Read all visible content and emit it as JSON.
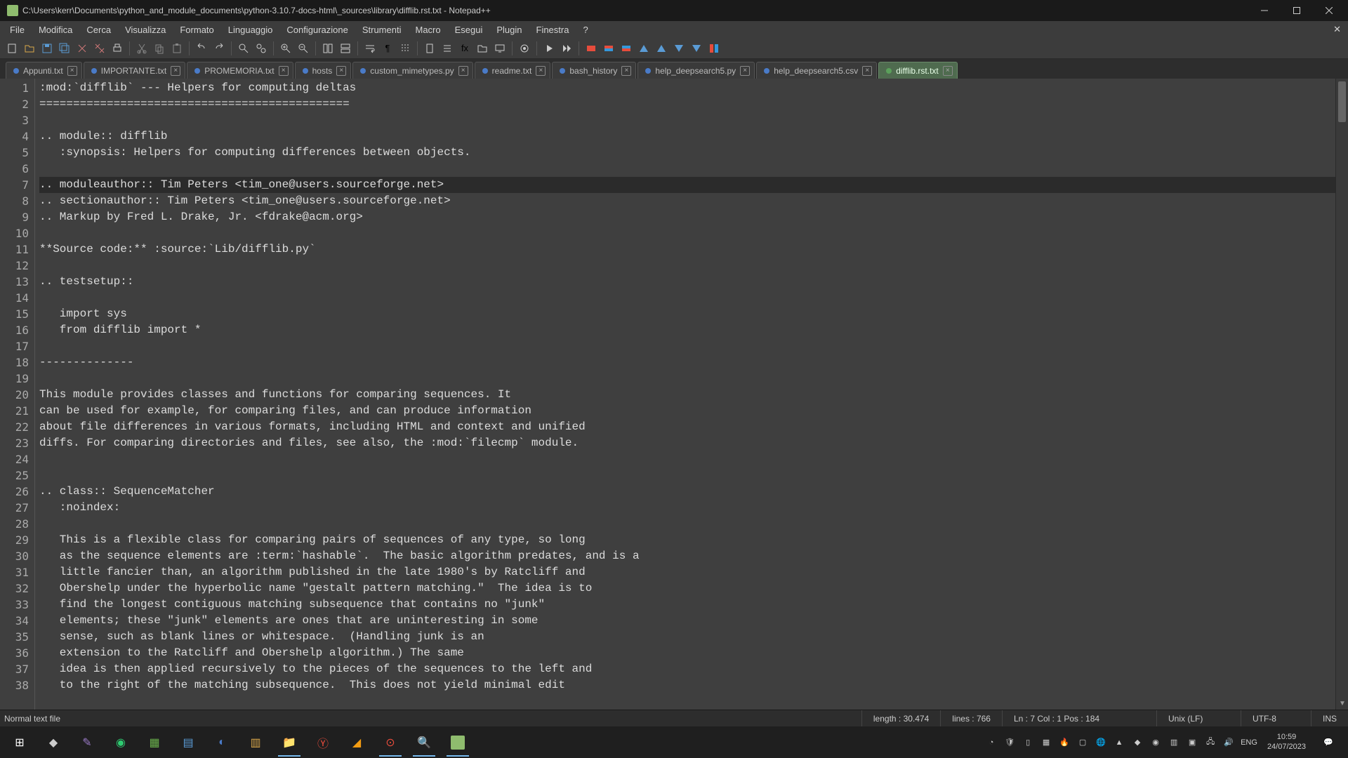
{
  "titlebar": {
    "title": "C:\\Users\\kerr\\Documents\\python_and_module_documents\\python-3.10.7-docs-html\\_sources\\library\\difflib.rst.txt - Notepad++"
  },
  "menu": {
    "items": [
      "File",
      "Modifica",
      "Cerca",
      "Visualizza",
      "Formato",
      "Linguaggio",
      "Configurazione",
      "Strumenti",
      "Macro",
      "Esegui",
      "Plugin",
      "Finestra",
      "?"
    ]
  },
  "tabs": [
    {
      "label": "Appunti.txt",
      "active": false
    },
    {
      "label": "IMPORTANTE.txt",
      "active": false
    },
    {
      "label": "PROMEMORIA.txt",
      "active": false
    },
    {
      "label": "hosts",
      "active": false
    },
    {
      "label": "custom_mimetypes.py",
      "active": false
    },
    {
      "label": "readme.txt",
      "active": false
    },
    {
      "label": "bash_history",
      "active": false
    },
    {
      "label": "help_deepsearch5.py",
      "active": false
    },
    {
      "label": "help_deepsearch5.csv",
      "active": false
    },
    {
      "label": "difflib.rst.txt",
      "active": true
    }
  ],
  "code_lines": [
    ":mod:`difflib` --- Helpers for computing deltas",
    "==============================================",
    "",
    ".. module:: difflib",
    "   :synopsis: Helpers for computing differences between objects.",
    "",
    ".. moduleauthor:: Tim Peters <tim_one@users.sourceforge.net>",
    ".. sectionauthor:: Tim Peters <tim_one@users.sourceforge.net>",
    ".. Markup by Fred L. Drake, Jr. <fdrake@acm.org>",
    "",
    "**Source code:** :source:`Lib/difflib.py`",
    "",
    ".. testsetup::",
    "",
    "   import sys",
    "   from difflib import *",
    "",
    "--------------",
    "",
    "This module provides classes and functions for comparing sequences. It",
    "can be used for example, for comparing files, and can produce information",
    "about file differences in various formats, including HTML and context and unified",
    "diffs. For comparing directories and files, see also, the :mod:`filecmp` module.",
    "",
    "",
    ".. class:: SequenceMatcher",
    "   :noindex:",
    "",
    "   This is a flexible class for comparing pairs of sequences of any type, so long",
    "   as the sequence elements are :term:`hashable`.  The basic algorithm predates, and is a",
    "   little fancier than, an algorithm published in the late 1980's by Ratcliff and",
    "   Obershelp under the hyperbolic name \"gestalt pattern matching.\"  The idea is to",
    "   find the longest contiguous matching subsequence that contains no \"junk\"",
    "   elements; these \"junk\" elements are ones that are uninteresting in some",
    "   sense, such as blank lines or whitespace.  (Handling junk is an",
    "   extension to the Ratcliff and Obershelp algorithm.) The same",
    "   idea is then applied recursively to the pieces of the sequences to the left and",
    "   to the right of the matching subsequence.  This does not yield minimal edit"
  ],
  "current_line_index": 6,
  "status": {
    "filetype": "Normal text file",
    "length": "length : 30.474",
    "lines": "lines : 766",
    "cursor": "Ln : 7    Col : 1    Pos : 184",
    "eol": "Unix (LF)",
    "encoding": "UTF-8",
    "mode": "INS"
  },
  "taskbar": {
    "lang": "ENG",
    "time": "10:59",
    "date": "24/07/2023"
  }
}
